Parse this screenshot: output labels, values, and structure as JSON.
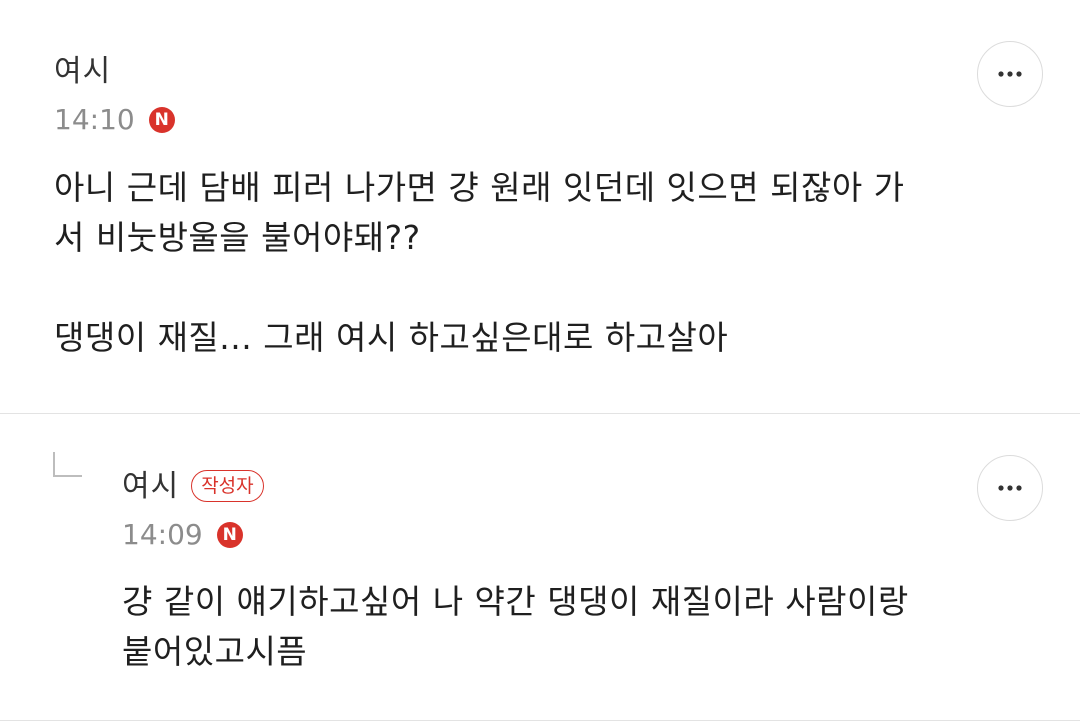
{
  "comments": [
    {
      "author": "여시",
      "time": "14:10",
      "new_badge": "N",
      "text": "아니 근데 담배 피러 나가면 걍 원래 잇던데 잇으면 되잖아 가\n서 비눗방울을 불어야돼??\n\n댕댕이 재질... 그래 여시 하고싶은대로 하고살아",
      "more_icon": "more-horizontal-icon"
    },
    {
      "author": "여시",
      "writer_badge": "작성자",
      "time": "14:09",
      "new_badge": "N",
      "text": "걍 같이 얘기하고싶어 나 약간 댕댕이 재질이라 사람이랑\n붙어있고시픔",
      "more_icon": "more-horizontal-icon",
      "reply_icon": "reply-arrow-icon"
    }
  ],
  "colors": {
    "badge_red": "#d9332b",
    "time_gray": "#8c8c8c",
    "divider": "#e3e3e3"
  }
}
